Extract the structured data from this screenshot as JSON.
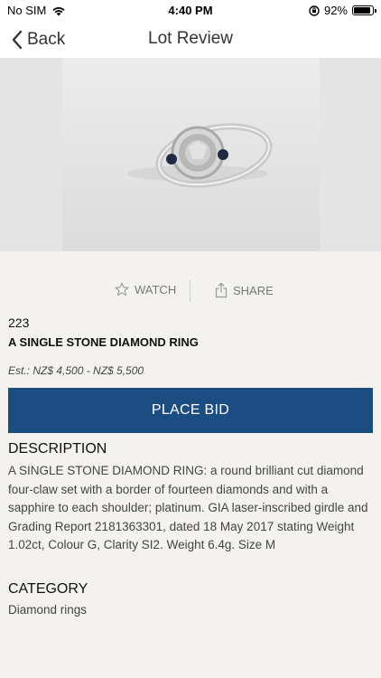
{
  "status_bar": {
    "carrier": "No SIM",
    "time": "4:40 PM",
    "battery_percent": "92%",
    "battery_level": 0.92
  },
  "nav": {
    "back_label": "Back",
    "title": "Lot Review"
  },
  "actions": {
    "watch_label": "WATCH",
    "share_label": "SHARE"
  },
  "lot": {
    "number": "223",
    "title": "A SINGLE STONE DIAMOND RING",
    "estimate": "Est.: NZ$ 4,500 - NZ$ 5,500",
    "bid_label": "PLACE BID"
  },
  "description": {
    "heading": "DESCRIPTION",
    "text": "A SINGLE STONE DIAMOND RING: a round brilliant cut diamond four-claw set with a border of fourteen diamonds and with a sapphire to each shoulder; platinum. GIA laser-inscribed girdle and Grading Report 2181363301, dated 18 May 2017 stating Weight 1.02ct, Colour G, Clarity SI2. Weight 6.4g. Size M"
  },
  "category": {
    "heading": "CATEGORY",
    "value": "Diamond rings"
  },
  "icons": [
    "wifi-icon",
    "orientation-lock-icon",
    "battery-icon",
    "chevron-left-icon",
    "star-icon",
    "share-icon"
  ],
  "colors": {
    "accent": "#1b4c82",
    "background": "#f4f2ee"
  }
}
